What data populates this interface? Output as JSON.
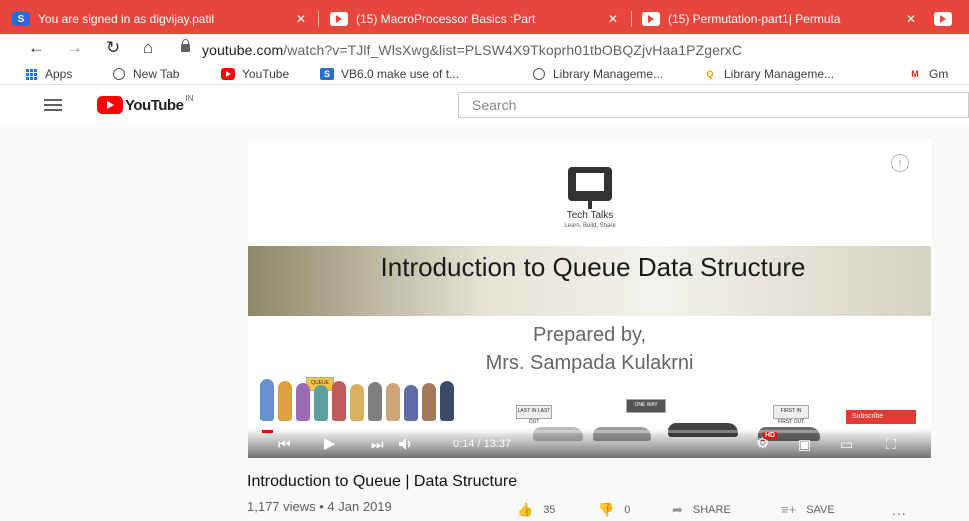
{
  "browser": {
    "tabs": [
      {
        "title": "You are signed in as digvijay.patil",
        "icon": "s-favicon",
        "active": true
      },
      {
        "title": "(15) MacroProcessor Basics :Part",
        "icon": "youtube-favicon"
      },
      {
        "title": "(15) Permutation-part1| Permuta",
        "icon": "youtube-favicon"
      }
    ],
    "url_host": "youtube.com",
    "url_path": "/watch?v=TJlf_WlsXwg&list=PLSW4X9Tkoprh01tbOBQZjvHaa1PZgerxC",
    "bookmarks": [
      {
        "label": "Apps",
        "icon": "apps-grid-icon"
      },
      {
        "label": "New Tab",
        "icon": "globe-icon"
      },
      {
        "label": "YouTube",
        "icon": "youtube-icon"
      },
      {
        "label": "VB6.0 make use of t...",
        "icon": "s-icon"
      },
      {
        "label": "Library Manageme...",
        "icon": "globe-icon"
      },
      {
        "label": "Library Manageme...",
        "icon": "q-icon"
      },
      {
        "label": "Gm",
        "icon": "gmail-icon"
      }
    ]
  },
  "youtube": {
    "logo_text": "YouTube",
    "country": "IN",
    "search_placeholder": "Search"
  },
  "video": {
    "brand_name": "Tech Talks",
    "brand_tagline": "Learn, Build, Share",
    "slide_title": "Introduction to Queue Data Structure",
    "prepared_by": "Prepared by,",
    "author": "Mrs. Sampada Kulakrni",
    "sign_labels": {
      "one_way": "ONE WAY",
      "lifo": "LAST IN LAST OUT",
      "fifo": "FIRST IN FIRST OUT",
      "queue": "QUEUE"
    },
    "subscribe_label": "Subscribe",
    "hd_label": "HD",
    "time": "0:14 / 13:37",
    "progress_fraction": 0.017,
    "title": "Introduction to Queue | Data Structure",
    "views_date": "1,177 views • 4 Jan 2019",
    "likes": "35",
    "dislikes": "0",
    "share_label": "SHARE",
    "save_label": "SAVE",
    "more_label": "..."
  },
  "colors": {
    "tabbar": "#e8453c",
    "youtube_red": "#ff0000"
  }
}
